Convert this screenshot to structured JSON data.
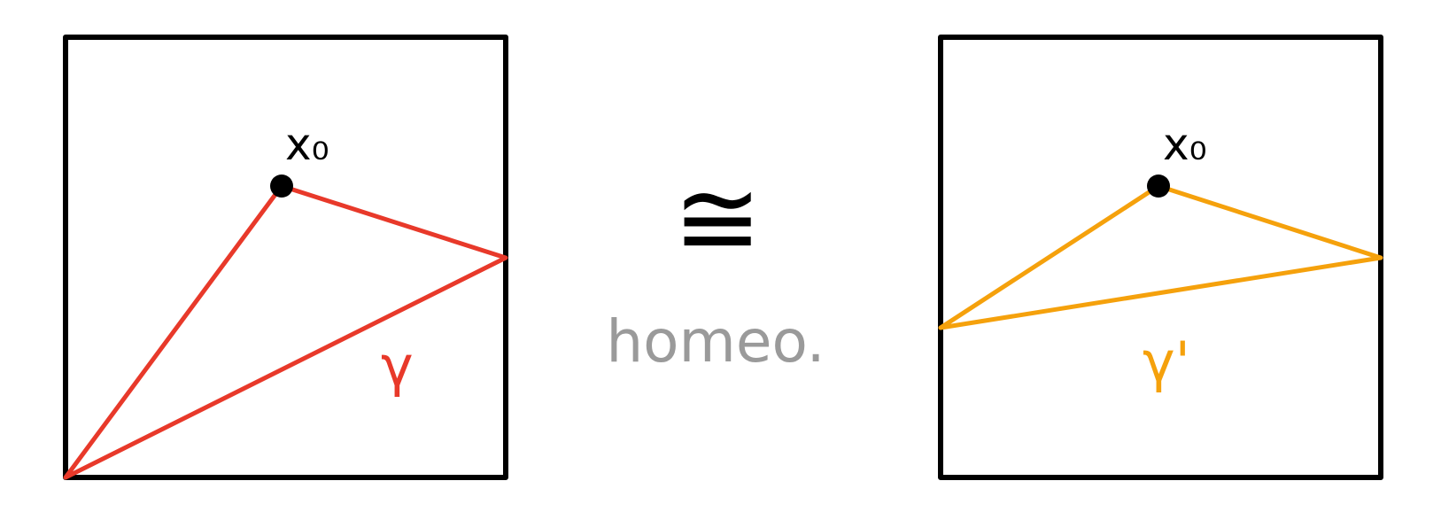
{
  "left_panel": {
    "point_label": "x₀",
    "path_label": "γ",
    "path_color": "#e8392a"
  },
  "middle": {
    "relation_symbol": "≅",
    "relation_caption": "homeo.",
    "caption_color": "#9a9a9a"
  },
  "right_panel": {
    "point_label": "x₀",
    "path_label": "γ'",
    "path_color": "#f5a10c"
  },
  "colors": {
    "frame": "#000000",
    "point": "#000000"
  }
}
